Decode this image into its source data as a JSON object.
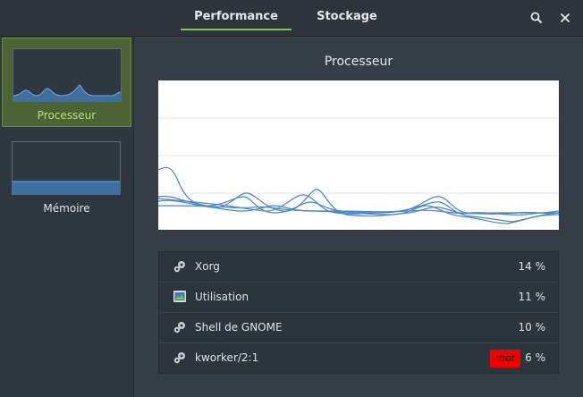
{
  "header": {
    "tabs": [
      {
        "label": "Performance",
        "active": true
      },
      {
        "label": "Stockage",
        "active": false
      }
    ],
    "search_icon": "search-icon",
    "close_icon": "close-icon"
  },
  "sidebar": {
    "items": [
      {
        "label": "Processeur",
        "selected": true
      },
      {
        "label": "Mémoire",
        "selected": false
      }
    ]
  },
  "main": {
    "title": "Processeur"
  },
  "processes": [
    {
      "name": "Xorg",
      "icon": "gear-icon",
      "percent": "14 %"
    },
    {
      "name": "Utilisation",
      "icon": "monitor-app-icon",
      "percent": "11 %"
    },
    {
      "name": "Shell de GNOME",
      "icon": "gear-icon",
      "percent": "10 %"
    },
    {
      "name": "kworker/2:1",
      "icon": "gear-icon",
      "percent": "6 %",
      "badge": "root"
    }
  ],
  "colors": {
    "accent": "#8cbf55",
    "selected_bg": "#4d6336",
    "line": "#4a86c8",
    "badge": "#ee0000"
  }
}
